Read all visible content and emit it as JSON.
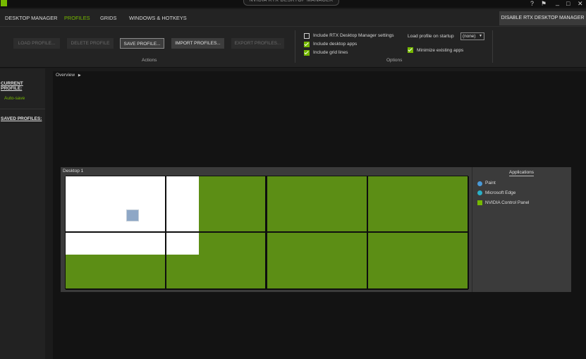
{
  "window": {
    "title": "NVIDIA RTX DESKTOP MANAGER",
    "controls": [
      "?",
      "⚑",
      "_",
      "□",
      "✕"
    ]
  },
  "nav": {
    "tabs": [
      "DESKTOP MANAGER",
      "PROFILES",
      "GRIDS",
      "WINDOWS & HOTKEYS"
    ],
    "active": "PROFILES",
    "disable_button": "DISABLE RTX DESKTOP MANAGER"
  },
  "actions": {
    "buttons": [
      "LOAD PROFILE...",
      "DELETE PROFILE",
      "SAVE PROFILE...",
      "IMPORT PROFILES...",
      "EXPORT PROFILES..."
    ],
    "enabled": [
      false,
      false,
      true,
      true,
      false
    ],
    "group_label": "Actions"
  },
  "options": {
    "checkboxes": [
      {
        "label": "Include RTX Desktop Manager settings",
        "checked": false
      },
      {
        "label": "Include desktop apps",
        "checked": true
      },
      {
        "label": "Include grid lines",
        "checked": true
      }
    ],
    "load_on_startup_label": "Load profile on startup",
    "load_on_startup_value": "(none)",
    "minimize_label": "Minimize existing apps",
    "minimize_checked": true,
    "group_label": "Options"
  },
  "sidebar": {
    "current_profile_heading": "CURRENT PROFILE:",
    "current_profile_value": "Auto-save",
    "saved_profiles_heading": "SAVED PROFILES:"
  },
  "main": {
    "breadcrumb": "Overview",
    "desktop_label": "Desktop 1",
    "applications_heading": "Applications",
    "applications": [
      {
        "name": "Paint",
        "icon": "paint-icon"
      },
      {
        "name": "Microsoft Edge",
        "icon": "edge-icon"
      },
      {
        "name": "NVIDIA Control Panel",
        "icon": "nvidia-control-panel-icon"
      }
    ]
  },
  "colors": {
    "accent": "#76b900",
    "grid_fill": "#5c8e15",
    "background": "#1b1b1b"
  }
}
